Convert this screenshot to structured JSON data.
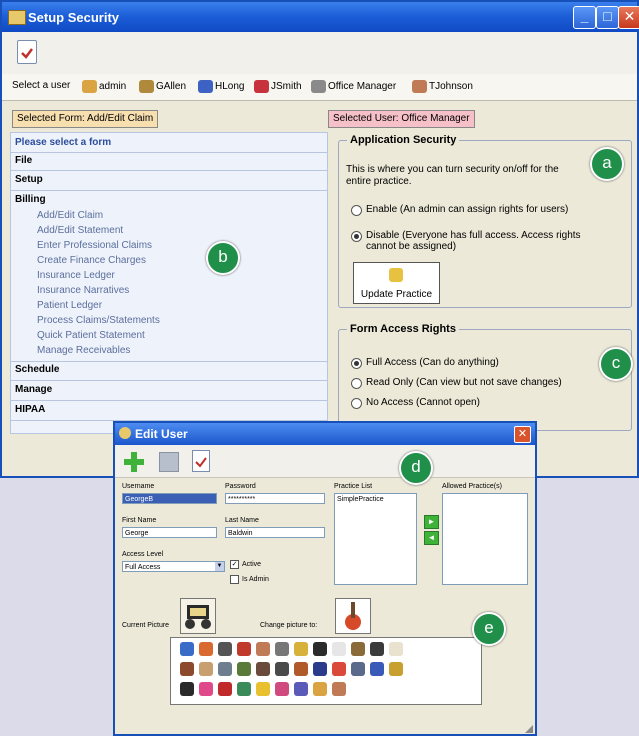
{
  "window": {
    "title": "Setup Security"
  },
  "userbar": {
    "label": "Select a user",
    "users": [
      {
        "name": "admin",
        "color": "#d9a441"
      },
      {
        "name": "GAllen",
        "color": "#b08a3c"
      },
      {
        "name": "HLong",
        "color": "#3d62c4"
      },
      {
        "name": "JSmith",
        "color": "#c8323c"
      },
      {
        "name": "Office Manager",
        "color": "#8a8a8a"
      },
      {
        "name": "TJohnson",
        "color": "#c07a55"
      }
    ]
  },
  "selected_form": "Selected Form: Add/Edit Claim",
  "selected_user": "Selected User: Office Manager",
  "forms": {
    "prompt": "Please select a form",
    "sections": [
      "File",
      "Setup",
      "Billing"
    ],
    "billing_items": [
      "Add/Edit Claim",
      "Add/Edit Statement",
      "Enter Professional Claims",
      "Create Finance Charges",
      "Insurance Ledger",
      "Insurance Narratives",
      "Patient Ledger",
      "Process Claims/Statements",
      "Quick Patient Statement",
      "Manage Receivables"
    ],
    "after_sections": [
      "Schedule",
      "Manage",
      "HIPAA"
    ]
  },
  "app_security": {
    "legend": "Application Security",
    "desc": "This is where you can turn security on/off for the entire practice.",
    "enable": "Enable (An admin can assign rights for users)",
    "disable": "Disable (Everyone has full access. Access rights cannot be assigned)",
    "update_button": "Update Practice"
  },
  "form_access": {
    "legend": "Form Access Rights",
    "full": "Full Access (Can do anything)",
    "readonly": "Read Only (Can view but not save changes)",
    "noaccess": "No Access (Cannot open)"
  },
  "badges": {
    "a": "a",
    "b": "b",
    "c": "c",
    "d": "d",
    "e": "e"
  },
  "edit_user": {
    "title": "Edit User",
    "username_label": "Username",
    "username": "GeorgeB",
    "password_label": "Password",
    "password": "**********",
    "first_label": "First Name",
    "first": "George",
    "last_label": "Last Name",
    "last": "Baldwin",
    "access_label": "Access Level",
    "access": "Full Access",
    "active_label": "Active",
    "admin_label": "Is Admin",
    "practice_label": "Practice List",
    "practice_item": "SimplePractice",
    "allowed_label": "Allowed Practice(s)",
    "current_pic_label": "Current Picture",
    "change_pic_label": "Change picture to:"
  },
  "picture_colors": [
    "#3b6bc8",
    "#d9692f",
    "#555555",
    "#c0392b",
    "#c07a55",
    "#777777",
    "#d8b13a",
    "#2b2b2b",
    "#e6e6e6",
    "#8b6a3a",
    "#3b3b3b",
    "#e8e2cf",
    "#8b4a2b",
    "#c8a070",
    "#6e7e8e",
    "#5a7a3a",
    "#6a4a3a",
    "#4a4a4a",
    "#b05a2a",
    "#2b3b8b",
    "#d94a3a",
    "#5a6a8a",
    "#3a5ab8",
    "#c8a030",
    "#2a2a2a",
    "#e04a8a",
    "#c02a2a",
    "#3a8a5a",
    "#e8c030",
    "#d04a80",
    "#5a5ab8",
    "#d9a441",
    "#c07a55"
  ]
}
